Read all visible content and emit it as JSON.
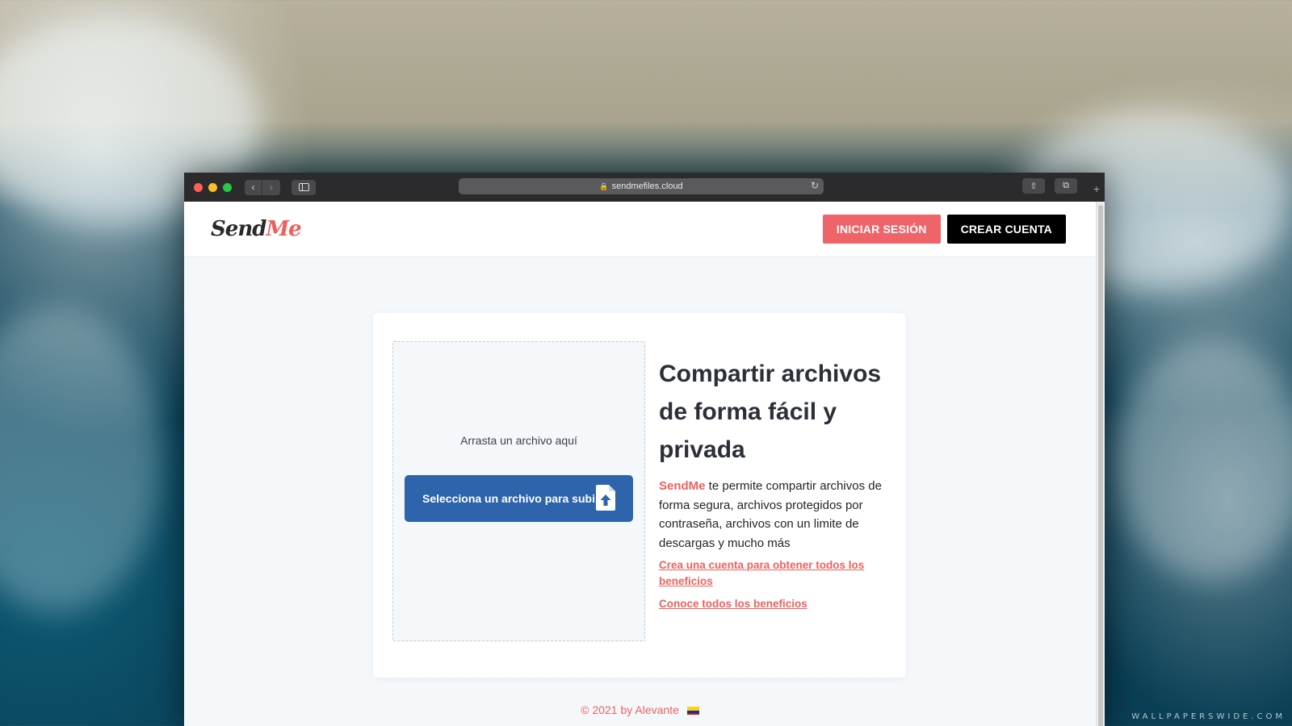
{
  "browser": {
    "url": "sendmefiles.cloud",
    "back_glyph": "‹",
    "forward_glyph": "›",
    "reload_glyph": "↻",
    "share_glyph": "⇧",
    "tabs_glyph": "⧉",
    "new_tab_glyph": "+"
  },
  "header": {
    "logo_part1": "Send",
    "logo_part2": "Me",
    "login_label": "INICIAR SESIÓN",
    "signup_label": "CREAR CUENTA"
  },
  "upload": {
    "drop_text": "Arrasta un archivo aquí",
    "select_label": "Selecciona un archivo para subir"
  },
  "hero": {
    "title": "Compartir archivos de forma fácil y privada",
    "brand": "SendMe",
    "description": " te permite compartir archivos de forma segura, archivos protegidos por contraseña, archivos con un limite de descargas y mucho más",
    "link_create_account": "Crea una cuenta para obtener todos los beneficios",
    "link_benefits": "Conoce todos los beneficios"
  },
  "footer": {
    "text": "© 2021 by Alevante"
  },
  "colors": {
    "accent": "#ef5f5c",
    "primary_button": "#2d64ac",
    "signup_button": "#000000",
    "login_button": "#ef6468"
  },
  "icons": {
    "upload": "file-upload-icon",
    "lock": "lock-icon",
    "flag": "colombia-flag-icon"
  },
  "watermark": "WALLPAPERSWIDE.COM"
}
